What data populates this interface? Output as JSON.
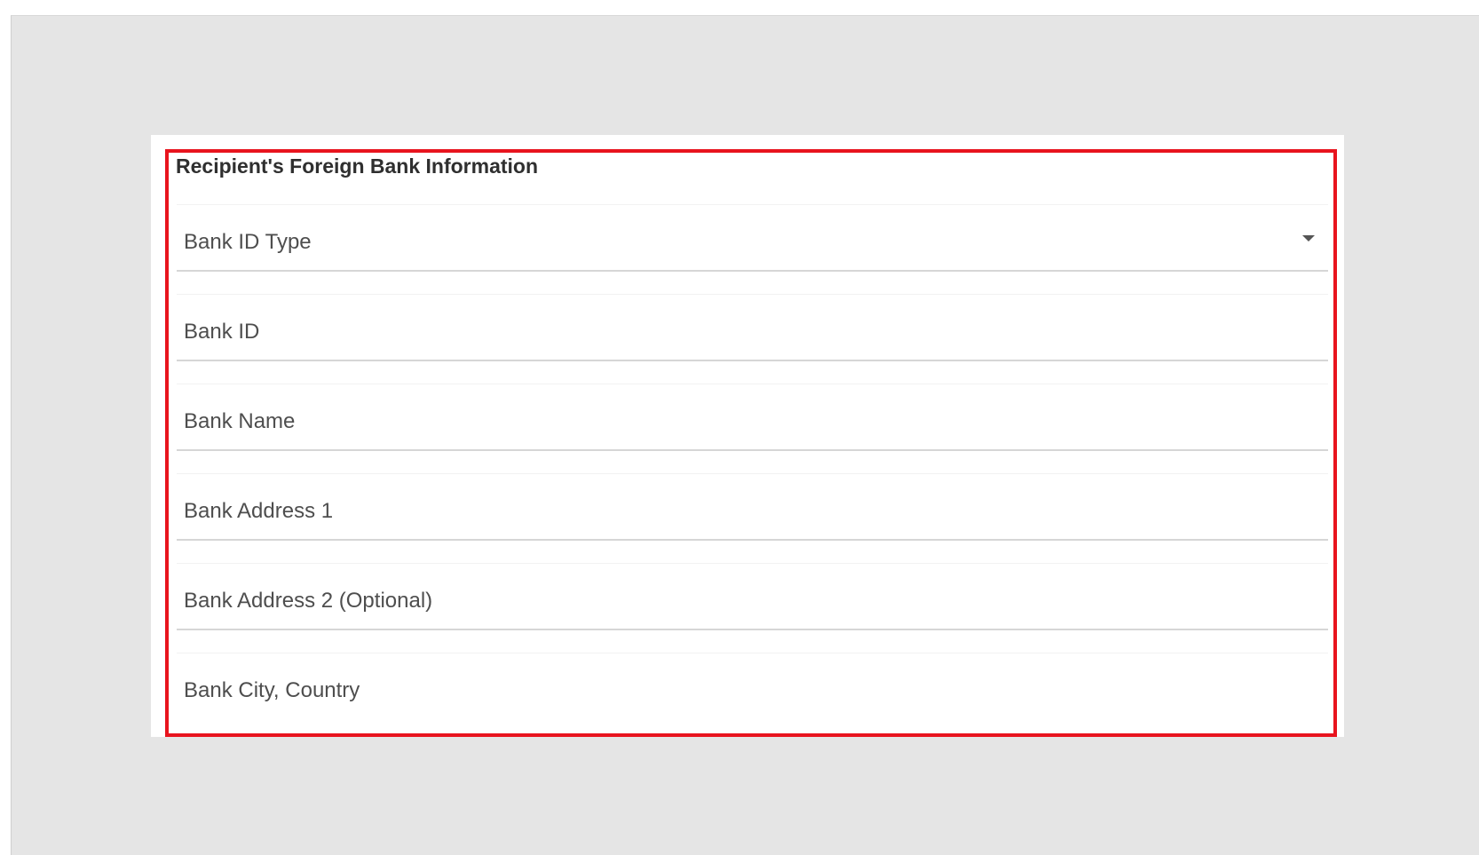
{
  "section": {
    "title": "Recipient's Foreign Bank Information"
  },
  "fields": [
    {
      "label": "Bank ID Type",
      "type": "select",
      "icon": "chevron-down-icon"
    },
    {
      "label": "Bank ID",
      "type": "text"
    },
    {
      "label": "Bank Name",
      "type": "text"
    },
    {
      "label": "Bank Address 1",
      "type": "text"
    },
    {
      "label": "Bank Address 2 (Optional)",
      "type": "text"
    },
    {
      "label": "Bank City, Country",
      "type": "text"
    }
  ],
  "colors": {
    "highlight": "#e8141e",
    "background": "#e5e5e5",
    "card": "#ffffff"
  }
}
